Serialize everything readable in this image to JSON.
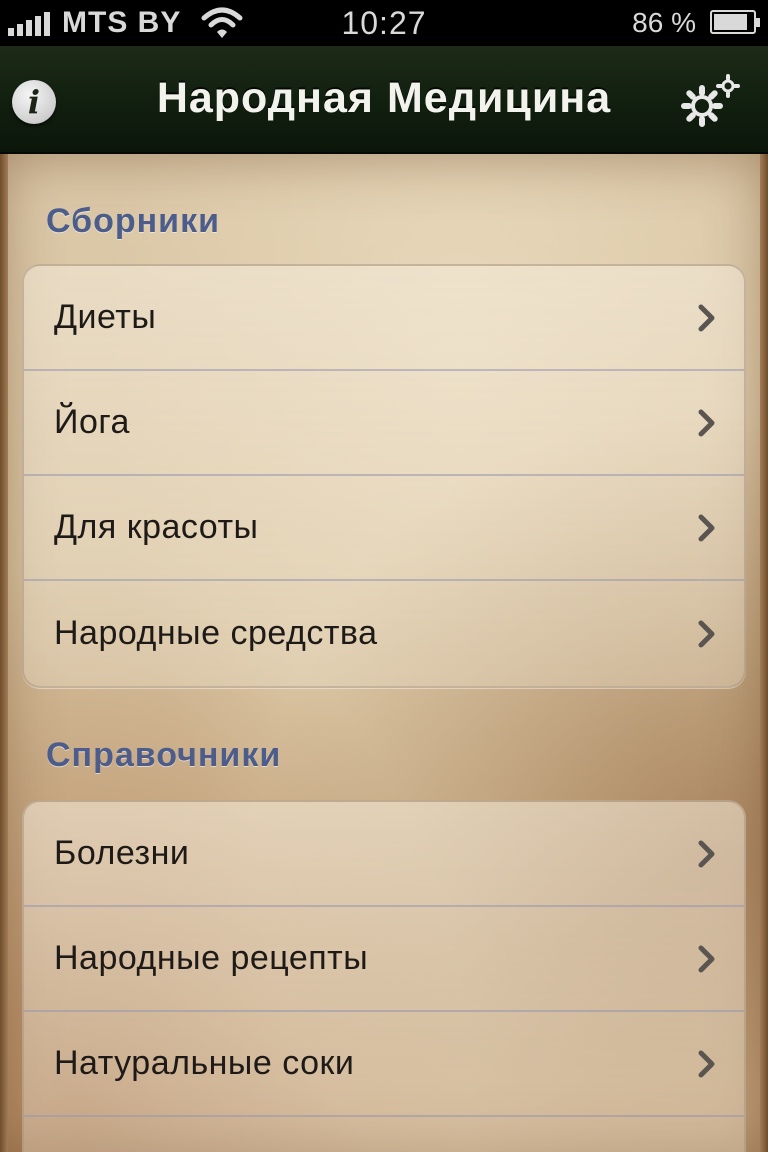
{
  "status_bar": {
    "carrier": "MTS BY",
    "time": "10:27",
    "battery_percent": "86 %",
    "battery_level": 0.86
  },
  "nav_bar": {
    "title": "Народная Медицина",
    "info_icon": "info-icon",
    "settings_icon": "gear-icon"
  },
  "sections": [
    {
      "header": "Сборники",
      "items": [
        {
          "label": "Диеты"
        },
        {
          "label": "Йога"
        },
        {
          "label": "Для красоты"
        },
        {
          "label": "Народные средства"
        }
      ]
    },
    {
      "header": "Справочники",
      "items": [
        {
          "label": "Болезни"
        },
        {
          "label": "Народные рецепты"
        },
        {
          "label": "Натуральные соки"
        }
      ]
    }
  ],
  "colors": {
    "section_header": "#4c5d8c",
    "nav_bar": "#122010",
    "row_text": "#1e1a17"
  }
}
